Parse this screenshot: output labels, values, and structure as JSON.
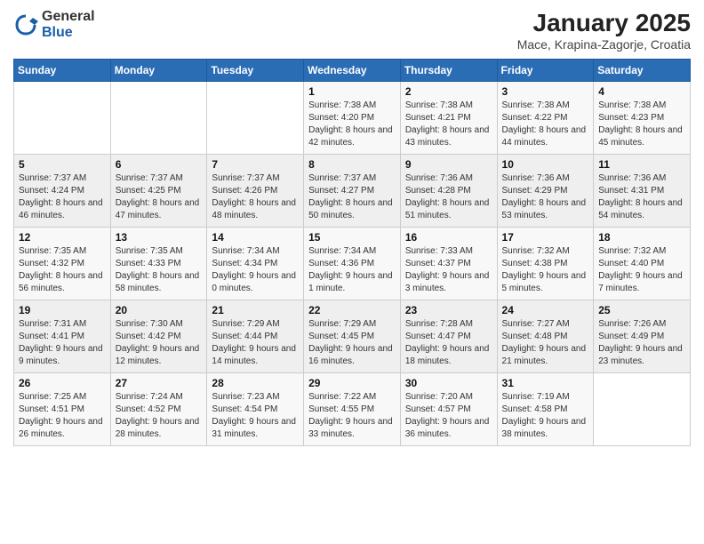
{
  "header": {
    "logo_general": "General",
    "logo_blue": "Blue",
    "main_title": "January 2025",
    "subtitle": "Mace, Krapina-Zagorje, Croatia"
  },
  "weekdays": [
    "Sunday",
    "Monday",
    "Tuesday",
    "Wednesday",
    "Thursday",
    "Friday",
    "Saturday"
  ],
  "weeks": [
    [
      {
        "day": "",
        "info": ""
      },
      {
        "day": "",
        "info": ""
      },
      {
        "day": "",
        "info": ""
      },
      {
        "day": "1",
        "info": "Sunrise: 7:38 AM\nSunset: 4:20 PM\nDaylight: 8 hours\nand 42 minutes."
      },
      {
        "day": "2",
        "info": "Sunrise: 7:38 AM\nSunset: 4:21 PM\nDaylight: 8 hours\nand 43 minutes."
      },
      {
        "day": "3",
        "info": "Sunrise: 7:38 AM\nSunset: 4:22 PM\nDaylight: 8 hours\nand 44 minutes."
      },
      {
        "day": "4",
        "info": "Sunrise: 7:38 AM\nSunset: 4:23 PM\nDaylight: 8 hours\nand 45 minutes."
      }
    ],
    [
      {
        "day": "5",
        "info": "Sunrise: 7:37 AM\nSunset: 4:24 PM\nDaylight: 8 hours\nand 46 minutes."
      },
      {
        "day": "6",
        "info": "Sunrise: 7:37 AM\nSunset: 4:25 PM\nDaylight: 8 hours\nand 47 minutes."
      },
      {
        "day": "7",
        "info": "Sunrise: 7:37 AM\nSunset: 4:26 PM\nDaylight: 8 hours\nand 48 minutes."
      },
      {
        "day": "8",
        "info": "Sunrise: 7:37 AM\nSunset: 4:27 PM\nDaylight: 8 hours\nand 50 minutes."
      },
      {
        "day": "9",
        "info": "Sunrise: 7:36 AM\nSunset: 4:28 PM\nDaylight: 8 hours\nand 51 minutes."
      },
      {
        "day": "10",
        "info": "Sunrise: 7:36 AM\nSunset: 4:29 PM\nDaylight: 8 hours\nand 53 minutes."
      },
      {
        "day": "11",
        "info": "Sunrise: 7:36 AM\nSunset: 4:31 PM\nDaylight: 8 hours\nand 54 minutes."
      }
    ],
    [
      {
        "day": "12",
        "info": "Sunrise: 7:35 AM\nSunset: 4:32 PM\nDaylight: 8 hours\nand 56 minutes."
      },
      {
        "day": "13",
        "info": "Sunrise: 7:35 AM\nSunset: 4:33 PM\nDaylight: 8 hours\nand 58 minutes."
      },
      {
        "day": "14",
        "info": "Sunrise: 7:34 AM\nSunset: 4:34 PM\nDaylight: 9 hours\nand 0 minutes."
      },
      {
        "day": "15",
        "info": "Sunrise: 7:34 AM\nSunset: 4:36 PM\nDaylight: 9 hours\nand 1 minute."
      },
      {
        "day": "16",
        "info": "Sunrise: 7:33 AM\nSunset: 4:37 PM\nDaylight: 9 hours\nand 3 minutes."
      },
      {
        "day": "17",
        "info": "Sunrise: 7:32 AM\nSunset: 4:38 PM\nDaylight: 9 hours\nand 5 minutes."
      },
      {
        "day": "18",
        "info": "Sunrise: 7:32 AM\nSunset: 4:40 PM\nDaylight: 9 hours\nand 7 minutes."
      }
    ],
    [
      {
        "day": "19",
        "info": "Sunrise: 7:31 AM\nSunset: 4:41 PM\nDaylight: 9 hours\nand 9 minutes."
      },
      {
        "day": "20",
        "info": "Sunrise: 7:30 AM\nSunset: 4:42 PM\nDaylight: 9 hours\nand 12 minutes."
      },
      {
        "day": "21",
        "info": "Sunrise: 7:29 AM\nSunset: 4:44 PM\nDaylight: 9 hours\nand 14 minutes."
      },
      {
        "day": "22",
        "info": "Sunrise: 7:29 AM\nSunset: 4:45 PM\nDaylight: 9 hours\nand 16 minutes."
      },
      {
        "day": "23",
        "info": "Sunrise: 7:28 AM\nSunset: 4:47 PM\nDaylight: 9 hours\nand 18 minutes."
      },
      {
        "day": "24",
        "info": "Sunrise: 7:27 AM\nSunset: 4:48 PM\nDaylight: 9 hours\nand 21 minutes."
      },
      {
        "day": "25",
        "info": "Sunrise: 7:26 AM\nSunset: 4:49 PM\nDaylight: 9 hours\nand 23 minutes."
      }
    ],
    [
      {
        "day": "26",
        "info": "Sunrise: 7:25 AM\nSunset: 4:51 PM\nDaylight: 9 hours\nand 26 minutes."
      },
      {
        "day": "27",
        "info": "Sunrise: 7:24 AM\nSunset: 4:52 PM\nDaylight: 9 hours\nand 28 minutes."
      },
      {
        "day": "28",
        "info": "Sunrise: 7:23 AM\nSunset: 4:54 PM\nDaylight: 9 hours\nand 31 minutes."
      },
      {
        "day": "29",
        "info": "Sunrise: 7:22 AM\nSunset: 4:55 PM\nDaylight: 9 hours\nand 33 minutes."
      },
      {
        "day": "30",
        "info": "Sunrise: 7:20 AM\nSunset: 4:57 PM\nDaylight: 9 hours\nand 36 minutes."
      },
      {
        "day": "31",
        "info": "Sunrise: 7:19 AM\nSunset: 4:58 PM\nDaylight: 9 hours\nand 38 minutes."
      },
      {
        "day": "",
        "info": ""
      }
    ]
  ]
}
